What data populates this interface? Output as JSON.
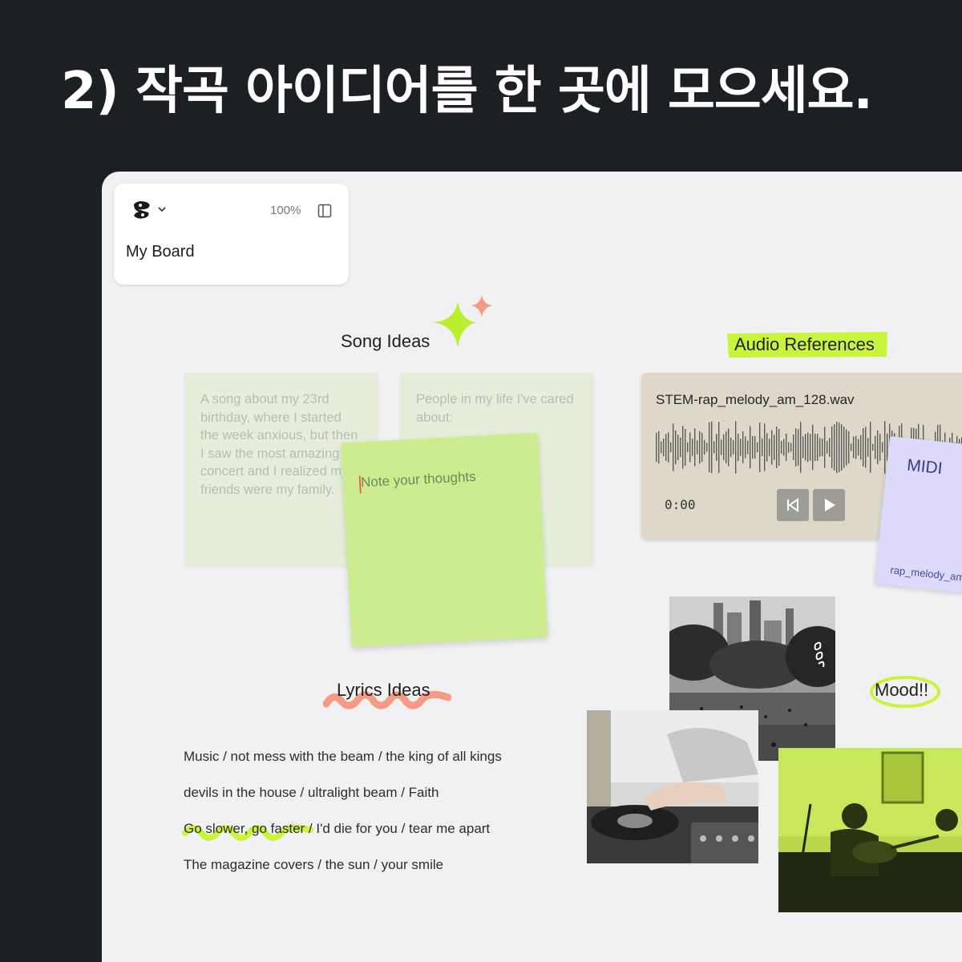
{
  "headline": "2) 작곡 아이디어를 한 곳에 모으세요.",
  "board": {
    "name": "My Board",
    "zoom": "100%",
    "logo_icon": "logo-icon",
    "panel_icon": "panel-toggle-icon"
  },
  "song_ideas": {
    "title": "Song Ideas",
    "notes": [
      "A song about my 23rd birthday, where I started the week anxious, but then I saw the most amazing concert and I realized my friends were my family.",
      "People in my life I've cared about:"
    ],
    "active_note_placeholder": "Note your thoughts"
  },
  "audio_references": {
    "title": "Audio References",
    "file_name": "STEM-rap_melody_am_128.wav",
    "time": "0:00",
    "midi_title": "MIDI",
    "midi_file": "rap_melody_am"
  },
  "lyrics_ideas": {
    "title": "Lyrics Ideas",
    "lines": [
      "Music / not mess with the beam / the king of all kings",
      "devils in the house / ultralight beam / Faith",
      "Go slower, go faster / I'd die for you / tear me apart",
      "The magazine covers / the sun / your smile"
    ]
  },
  "mood": {
    "title": "Mood!!"
  },
  "colors": {
    "accent_lime": "#c8f53b",
    "accent_coral": "#f59a84",
    "note_green": "#cdec8f",
    "midi_lavender": "#ddd9fb",
    "audio_tan": "#ded8ca"
  }
}
